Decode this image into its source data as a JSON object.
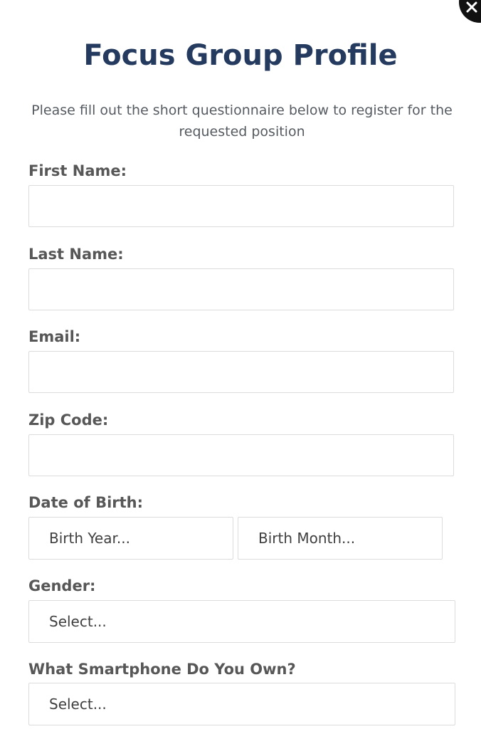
{
  "form": {
    "title": "Focus Group Profile",
    "intro": "Please fill out the short questionnaire below to register for the requested position",
    "first_name": {
      "label": "First Name:",
      "value": ""
    },
    "last_name": {
      "label": "Last Name:",
      "value": ""
    },
    "email": {
      "label": "Email:",
      "value": ""
    },
    "zip_code": {
      "label": "Zip Code:",
      "value": ""
    },
    "dob": {
      "label": "Date of Birth:",
      "year_placeholder": "Birth Year...",
      "month_placeholder": "Birth Month..."
    },
    "gender": {
      "label": "Gender:",
      "selected": "Select..."
    },
    "smartphone": {
      "label": "What Smartphone Do You Own?",
      "selected": "Select..."
    }
  },
  "icons": {
    "close": "close-icon"
  },
  "colors": {
    "title": "#243a5e",
    "label": "#575757",
    "body_text": "#555b61",
    "border": "#dcdcdc",
    "close_button": "#111111"
  }
}
